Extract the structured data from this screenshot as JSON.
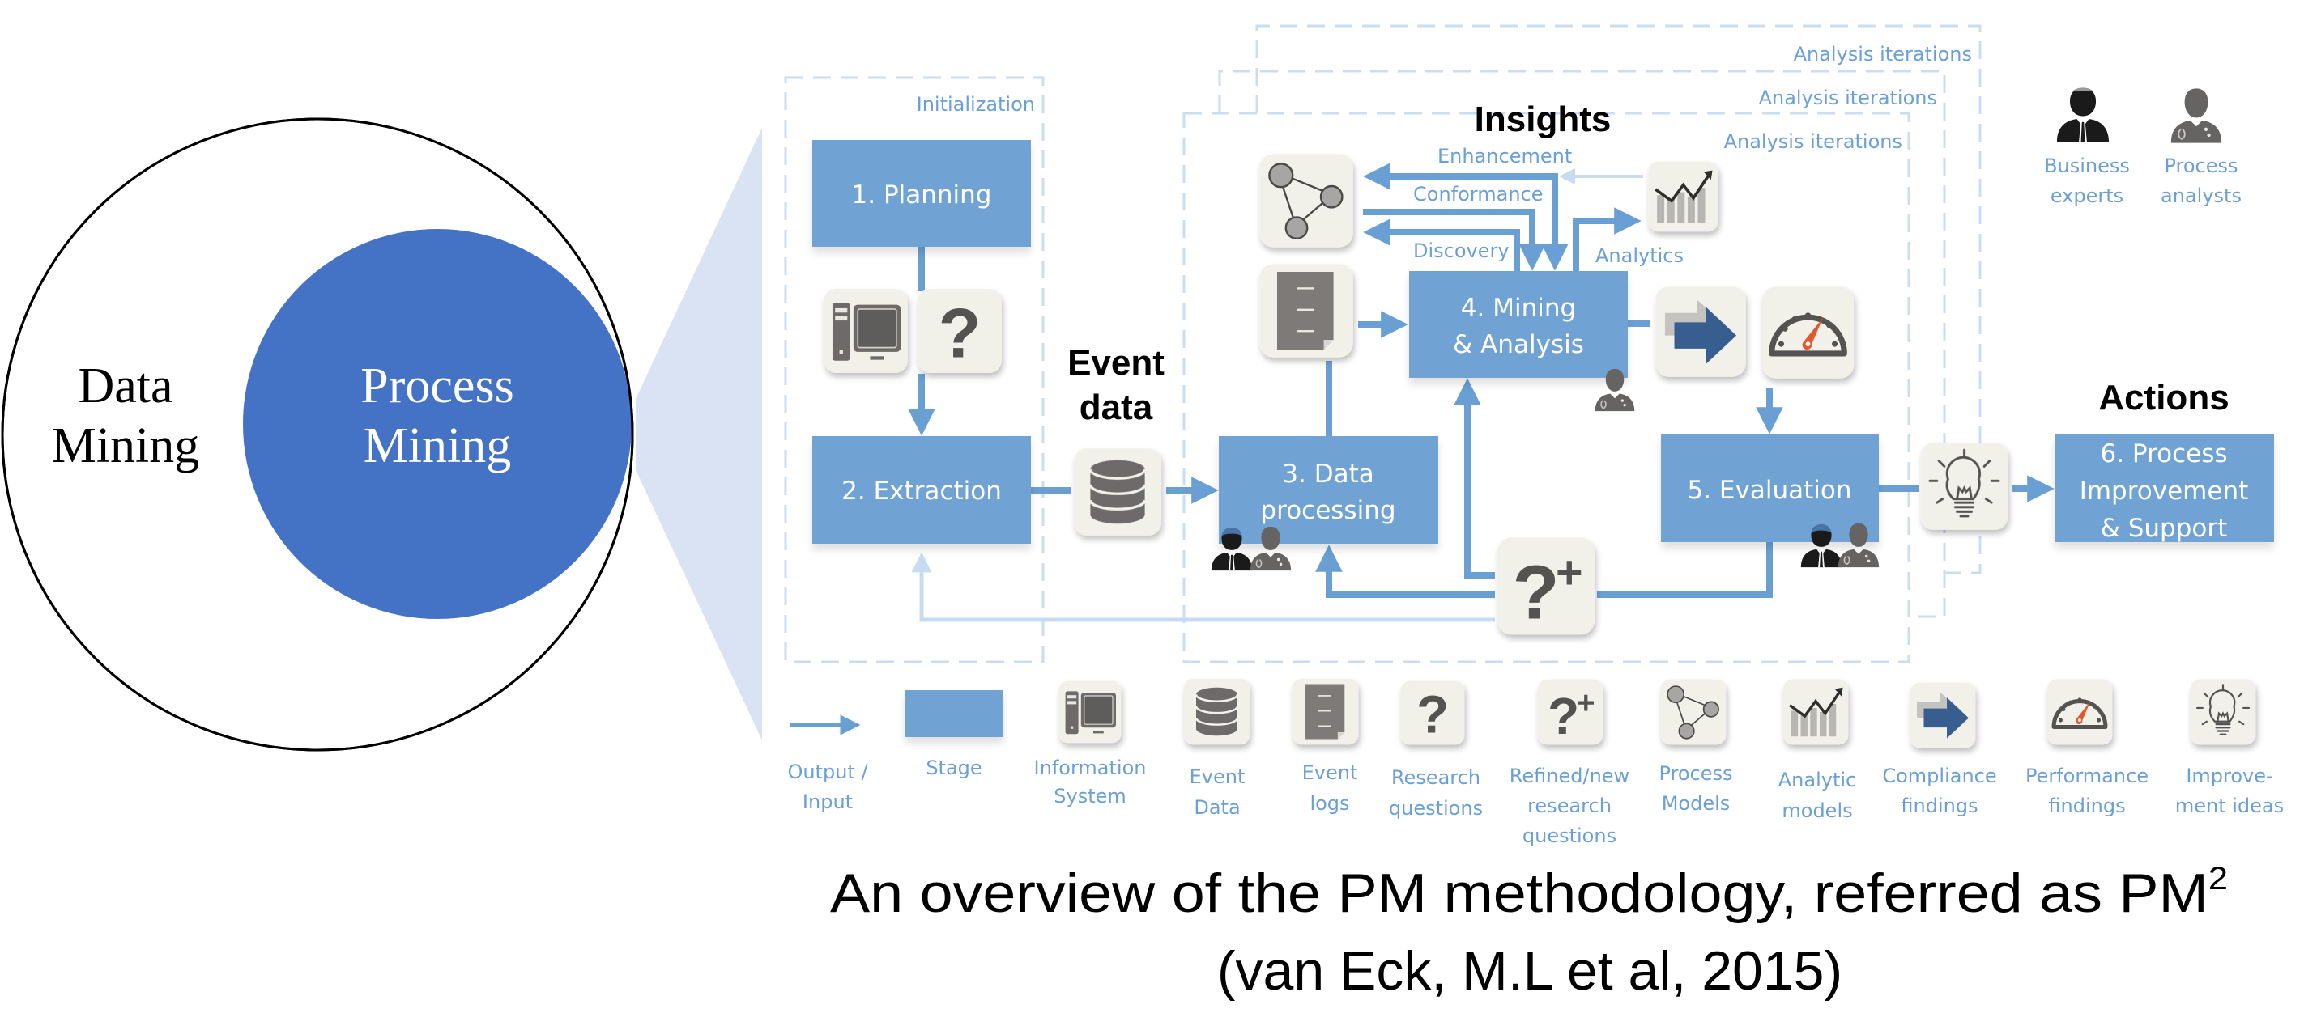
{
  "venn": {
    "outer_label_line1": "Data",
    "outer_label_line2": "Mining",
    "inner_label_line1": "Process",
    "inner_label_line2": "Mining",
    "outer_fill": "#ffffff",
    "outer_stroke": "#000000",
    "inner_fill": "#4472c4",
    "zoom_wedge_color": "#dae3f3"
  },
  "colors": {
    "stage": "#70a3d4",
    "arrow": "#6a9fd3",
    "arrow_light": "#c7dcf1",
    "dashed": "#c9ddf3",
    "label_text": "#6a9fd8",
    "icon_bg": "#f1f1ea",
    "icon_dark": "#6d6b69",
    "compliance_arrow": "#385d8f",
    "gauge_needle": "#e0582d"
  },
  "groups": {
    "initialization": "Initialization",
    "iterations": [
      "Analysis iterations",
      "Analysis iterations",
      "Analysis iterations"
    ]
  },
  "headings": {
    "insights": "Insights",
    "event_data_line1": "Event",
    "event_data_line2": "data",
    "actions": "Actions"
  },
  "stages": {
    "planning": "1. Planning",
    "extraction": "2. Extraction",
    "data_processing_line1": "3. Data",
    "data_processing_line2": "processing",
    "mining_line1": "4. Mining",
    "mining_line2": "& Analysis",
    "evaluation": "5. Evaluation",
    "improvement_line1": "6. Process",
    "improvement_line2": "Improvement",
    "improvement_line3": "& Support"
  },
  "flows": {
    "enhancement": "Enhancement",
    "conformance": "Conformance",
    "discovery": "Discovery",
    "analytics": "Analytics"
  },
  "actors": {
    "business_line1": "Business",
    "business_line2": "experts",
    "analysts_line1": "Process",
    "analysts_line2": "analysts"
  },
  "legend": [
    {
      "icon": "arrow-icon",
      "lines": [
        "Output /",
        "Input"
      ]
    },
    {
      "icon": "stage-swatch",
      "lines": [
        "Stage"
      ]
    },
    {
      "icon": "computer-icon",
      "lines": [
        "Information",
        "System"
      ]
    },
    {
      "icon": "database-icon",
      "lines": [
        "Event",
        "Data"
      ]
    },
    {
      "icon": "document-icon",
      "lines": [
        "Event",
        "logs"
      ]
    },
    {
      "icon": "question-icon",
      "lines": [
        "Research",
        "questions"
      ]
    },
    {
      "icon": "question-plus-icon",
      "lines": [
        "Refined/new",
        "research",
        "questions"
      ]
    },
    {
      "icon": "process-model-icon",
      "lines": [
        "Process",
        "Models"
      ]
    },
    {
      "icon": "chart-icon",
      "lines": [
        "Analytic",
        "models"
      ]
    },
    {
      "icon": "compliance-arrow-icon",
      "lines": [
        "Compliance",
        "findings"
      ]
    },
    {
      "icon": "gauge-icon",
      "lines": [
        "Performance",
        "findings"
      ]
    },
    {
      "icon": "lightbulb-icon",
      "lines": [
        "Improve-",
        "ment ideas"
      ]
    }
  ],
  "caption": {
    "line1_main": "An overview of the PM methodology, referred as PM",
    "line1_sup": "2",
    "line2": "(van Eck, M.L et al, 2015)"
  }
}
